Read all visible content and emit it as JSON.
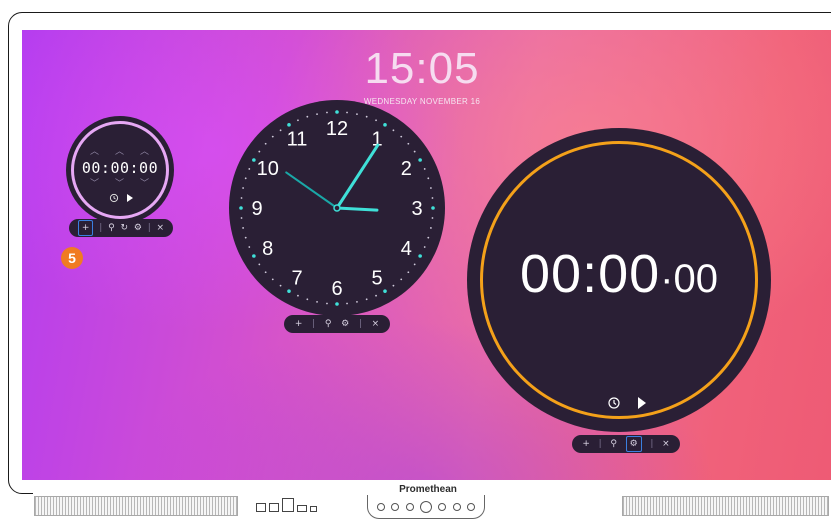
{
  "device": {
    "brand": "Promethean"
  },
  "header": {
    "time": "15:05",
    "date": "WEDNESDAY NOVEMBER 16"
  },
  "timer": {
    "digits": "00:00:00",
    "toolbar": {
      "add": "+",
      "sep": "|",
      "zoom": "⚲",
      "reset": "↻",
      "settings": "⚙",
      "close": "×"
    }
  },
  "step_badge": "5",
  "clock": {
    "numbers": [
      "12",
      "1",
      "2",
      "3",
      "4",
      "5",
      "6",
      "7",
      "8",
      "9",
      "10",
      "11"
    ],
    "time_shown": "1:15",
    "accent": "#3fe0d8",
    "toolbar": {
      "add": "+",
      "sep": "|",
      "zoom": "⚲",
      "settings": "⚙",
      "close": "×"
    }
  },
  "stopwatch": {
    "main": "00:00",
    "ms": "00",
    "accent": "#f4a11a",
    "toolbar": {
      "add": "+",
      "sep": "|",
      "zoom": "⚲",
      "settings": "⚙",
      "close": "×"
    }
  },
  "colors": {
    "widget_bg": "#2a1f35",
    "timer_ring": "#e6a8f4",
    "badge": "#f07b22"
  }
}
